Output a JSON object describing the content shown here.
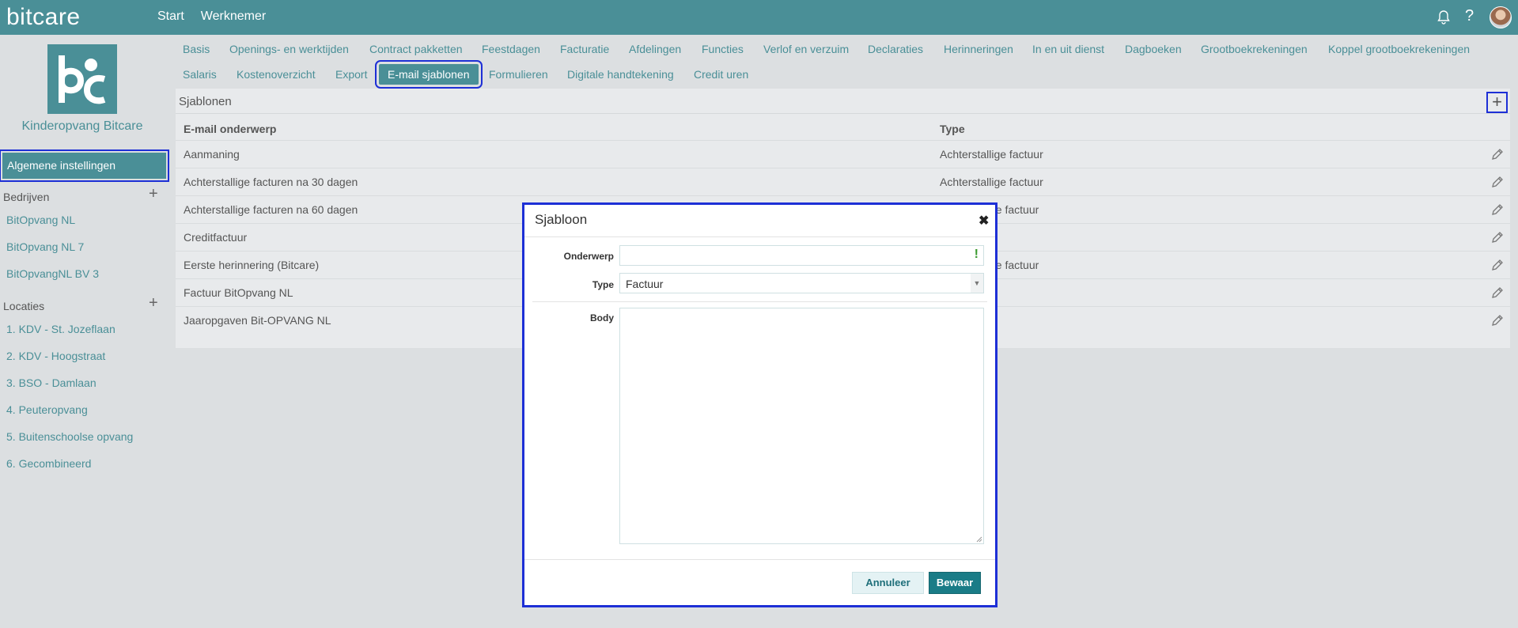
{
  "app": {
    "logo_text": "bitcare"
  },
  "topnav": {
    "items": [
      "Start",
      "Werknemer"
    ]
  },
  "sidebar": {
    "brand_name": "Kinderopvang Bitcare",
    "active_item": "Algemene instellingen",
    "sections": {
      "bedrijven": {
        "label": "Bedrijven",
        "items": [
          "BitOpvang NL",
          "BitOpvang NL 7",
          "BitOpvangNL BV 3"
        ]
      },
      "locaties": {
        "label": "Locaties",
        "items": [
          "1. KDV - St. Jozeflaan",
          "2. KDV - Hoogstraat",
          "3. BSO - Damlaan",
          "4. Peuteropvang",
          "5. Buitenschoolse opvang",
          "6. Gecombineerd"
        ]
      }
    }
  },
  "tabs": {
    "row1": [
      "Basis",
      "Openings- en werktijden",
      "Contract pakketten",
      "Feestdagen",
      "Facturatie",
      "Afdelingen",
      "Functies",
      "Verlof en verzuim",
      "Declaraties",
      "Herinneringen",
      "In en uit dienst",
      "Dagboeken",
      "Grootboekrekeningen",
      "Koppel grootboekrekeningen"
    ],
    "row2": [
      "Salaris",
      "Kostenoverzicht",
      "Export",
      "E-mail sjablonen",
      "Formulieren",
      "Digitale handtekening",
      "Credit uren"
    ],
    "active": "E-mail sjablonen"
  },
  "panel": {
    "title": "Sjablonen",
    "add_label": "+",
    "columns": [
      "E-mail onderwerp",
      "Type"
    ],
    "rows": [
      {
        "subject": "Aanmaning",
        "type": "Achterstallige factuur"
      },
      {
        "subject": "Achterstallige facturen na 30 dagen",
        "type": "Achterstallige factuur"
      },
      {
        "subject": "Achterstallige facturen na 60 dagen",
        "type": "ge factuur"
      },
      {
        "subject": "Creditfactuur",
        "type": ""
      },
      {
        "subject": "Eerste herinnering (Bitcare)",
        "type": "ge factuur"
      },
      {
        "subject": "Factuur BitOpvang NL",
        "type": ""
      },
      {
        "subject": "Jaaropgaven Bit-OPVANG NL",
        "type": ""
      }
    ]
  },
  "modal": {
    "title": "Sjabloon",
    "close": "✖",
    "subject_label": "Onderwerp",
    "subject_value": "",
    "required_mark": "!",
    "type_label": "Type",
    "type_value": "Factuur",
    "body_label": "Body",
    "body_value": "",
    "cancel_label": "Annuleer",
    "save_label": "Bewaar"
  },
  "colors": {
    "brand": "#4a8f97",
    "highlight": "#1d2fd6",
    "save": "#1a7c87"
  }
}
